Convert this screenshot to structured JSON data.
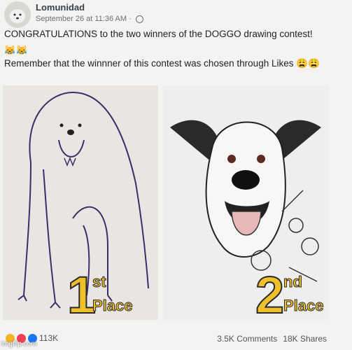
{
  "post": {
    "author": "Lomunidad",
    "timestamp": "September 26 at 11:36 AM ·",
    "text_line1": "CONGRATULATIONS to the two winners of the DOGGO drawing contest!",
    "emoji_line": "😹😹",
    "text_line2": "Remember that the winnner of this contest was chosen through Likes 😩😩"
  },
  "images": {
    "first": {
      "number": "1",
      "suffix": "st",
      "word": "Place"
    },
    "second": {
      "number": "2",
      "suffix": "nd",
      "word": "Place"
    }
  },
  "footer": {
    "reactions_count": "113K",
    "comments": "3.5K Comments",
    "shares": "18K Shares"
  },
  "watermark": "imgflip.com",
  "colors": {
    "accent_yellow": "#f0c02a",
    "link_blue": "#1877f2"
  }
}
